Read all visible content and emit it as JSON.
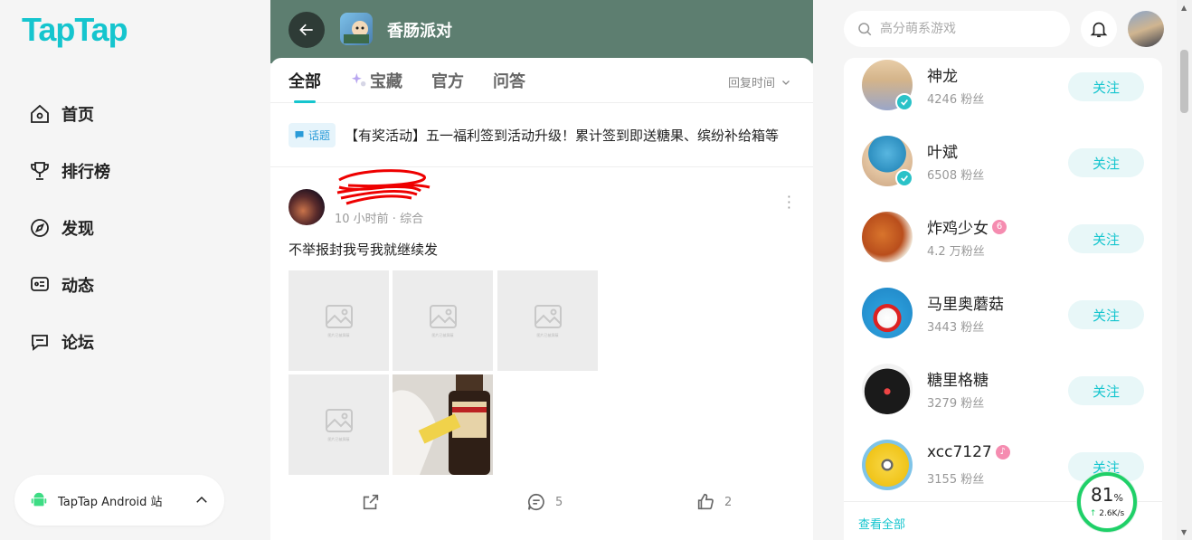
{
  "brand": {
    "logo": "TapTap",
    "accent": "#15c5ce"
  },
  "nav": {
    "items": [
      {
        "label": "首页",
        "icon": "home-icon"
      },
      {
        "label": "排行榜",
        "icon": "trophy-icon"
      },
      {
        "label": "发现",
        "icon": "discover-icon"
      },
      {
        "label": "动态",
        "icon": "feed-icon"
      },
      {
        "label": "论坛",
        "icon": "forum-icon"
      }
    ]
  },
  "android": {
    "label": "TapTap Android 站"
  },
  "game": {
    "title": "香肠派对"
  },
  "tabs": {
    "items": [
      "全部",
      "宝藏",
      "官方",
      "问答"
    ],
    "active": "全部",
    "sort_label": "回复时间"
  },
  "topic": {
    "badge": "话题",
    "text": "【有奖活动】五一福利签到活动升级！累计签到即送糖果、缤纷补给箱等"
  },
  "post": {
    "meta": "10 小时前 · 综合",
    "text": "不举报封我号我就继续发",
    "image_caption": "图片已被屏蔽",
    "share_count": "",
    "comment_count": "5",
    "like_count": "2"
  },
  "search": {
    "placeholder": "高分萌系游戏"
  },
  "follow": {
    "button_label": "关注",
    "see_all": "查看全部",
    "users": [
      {
        "name": "神龙",
        "fans": "4246 粉丝",
        "verified": true
      },
      {
        "name": "叶斌",
        "fans": "6508 粉丝",
        "verified": true
      },
      {
        "name": "炸鸡少女",
        "fans": "4.2 万粉丝",
        "verified": false
      },
      {
        "name": "马里奥蘑菇",
        "fans": "3443 粉丝",
        "verified": false
      },
      {
        "name": "糖里格糖",
        "fans": "3279 粉丝",
        "verified": false
      },
      {
        "name": "xcc7127",
        "fans": "3155 粉丝",
        "verified": false
      }
    ]
  },
  "speed_widget": {
    "percent": "81",
    "unit": "%",
    "rate": "2.6K/s"
  }
}
